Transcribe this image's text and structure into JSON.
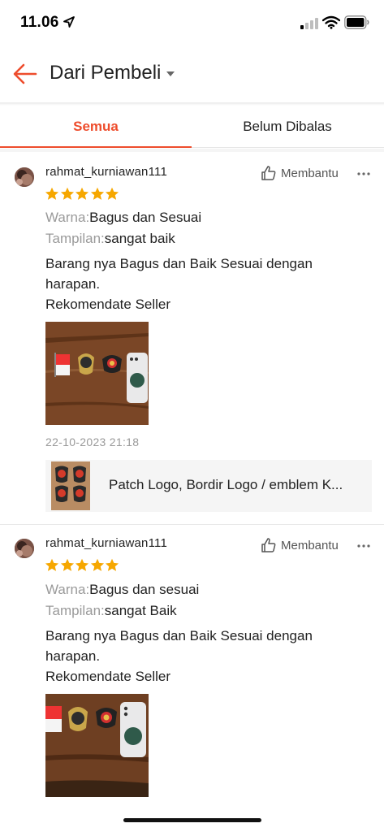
{
  "status_bar": {
    "time": "11.06"
  },
  "header": {
    "title": "Dari Pembeli"
  },
  "tabs": [
    {
      "label": "Semua",
      "active": true
    },
    {
      "label": "Belum Dibalas",
      "active": false
    }
  ],
  "colors": {
    "accent": "#ee4d2d",
    "star": "#f6a700",
    "muted": "#9a9a9a"
  },
  "reviews": [
    {
      "username": "rahmat_kurniawan111",
      "helpful_label": "Membantu",
      "rating": 5,
      "attributes": [
        {
          "key": "Warna:",
          "value": "Bagus dan Sesuai"
        },
        {
          "key": "Tampilan:",
          "value": "sangat baik"
        }
      ],
      "comment_lines": [
        "Barang nya Bagus dan Baik Sesuai dengan",
        "harapan.",
        "Rekomendate Seller"
      ],
      "date": "22-10-2023 21:18",
      "product_name": "Patch Logo, Bordir Logo / emblem K..."
    },
    {
      "username": "rahmat_kurniawan111",
      "helpful_label": "Membantu",
      "rating": 5,
      "attributes": [
        {
          "key": "Warna:",
          "value": "Bagus dan sesuai"
        },
        {
          "key": "Tampilan:",
          "value": "sangat Baik"
        }
      ],
      "comment_lines": [
        "Barang nya Bagus dan Baik Sesuai dengan",
        "harapan.",
        "Rekomendate Seller"
      ]
    }
  ]
}
